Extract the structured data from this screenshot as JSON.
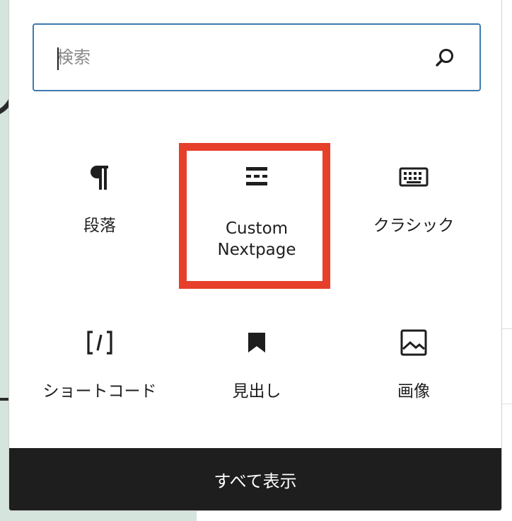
{
  "search": {
    "placeholder": "検索",
    "value": ""
  },
  "blocks": [
    {
      "label": "段落",
      "icon": "paragraph-icon"
    },
    {
      "label": "Custom\nNextpage",
      "icon": "page-break-icon",
      "highlighted": true
    },
    {
      "label": "クラシック",
      "icon": "keyboard-icon"
    },
    {
      "label": "ショートコード",
      "icon": "shortcode-icon"
    },
    {
      "label": "見出し",
      "icon": "bookmark-icon"
    },
    {
      "label": "画像",
      "icon": "image-icon"
    }
  ],
  "footer": {
    "browse_all_label": "すべて表示"
  },
  "colors": {
    "highlight": "#e6402a",
    "search_border": "#3e7ab0",
    "footer_bg": "#1e1e1e"
  }
}
